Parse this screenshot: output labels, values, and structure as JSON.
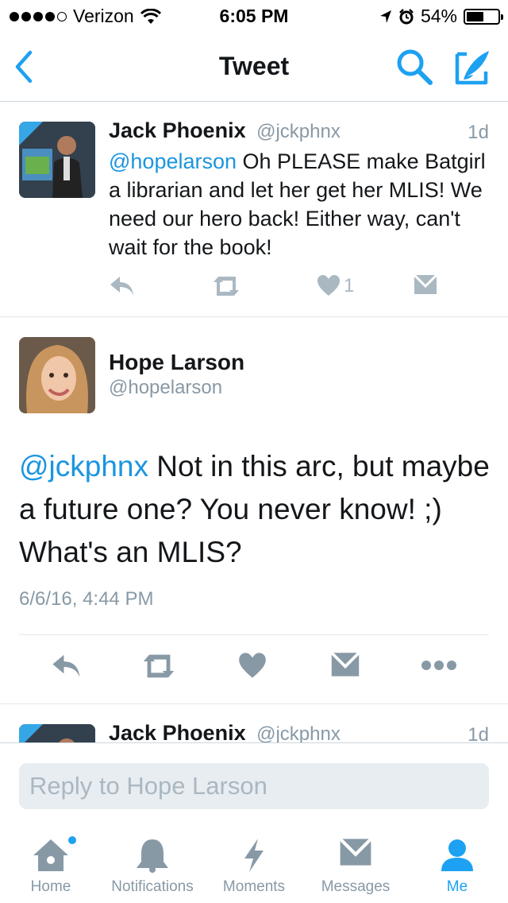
{
  "status_bar": {
    "carrier": "Verizon",
    "time": "6:05 PM",
    "battery": "54%",
    "battery_level": 0.54
  },
  "nav": {
    "title": "Tweet",
    "icons": [
      "back-chevron-icon",
      "search-icon",
      "compose-icon"
    ]
  },
  "parent_tweet": {
    "name": "Jack Phoenix",
    "handle": "@jckphnx",
    "time": "1d",
    "mention": "@hopelarson",
    "text": " Oh PLEASE make Batgirl a librarian and let her get her MLIS! We need our hero back! Either way, can't wait for the book!",
    "like_count": "1"
  },
  "main_tweet": {
    "name": "Hope Larson",
    "handle": "@hopelarson",
    "mention": "@jckphnx",
    "text": " Not in this arc, but maybe a future one? You never know! ;) What's an MLIS?",
    "timestamp": "6/6/16, 4:44 PM"
  },
  "next_tweet": {
    "name": "Jack Phoenix",
    "handle": "@jckphnx",
    "time": "1d"
  },
  "reply": {
    "placeholder": "Reply to Hope Larson"
  },
  "tabs": [
    {
      "label": "Home",
      "icon": "home-icon"
    },
    {
      "label": "Notifications",
      "icon": "bell-icon"
    },
    {
      "label": "Moments",
      "icon": "lightning-icon"
    },
    {
      "label": "Messages",
      "icon": "envelope-icon"
    },
    {
      "label": "Me",
      "icon": "person-icon"
    }
  ],
  "colors": {
    "accent": "#1da1f2",
    "mention": "#1b95e0",
    "muted": "#8899a6",
    "icon_gray": "#aab8c2"
  }
}
